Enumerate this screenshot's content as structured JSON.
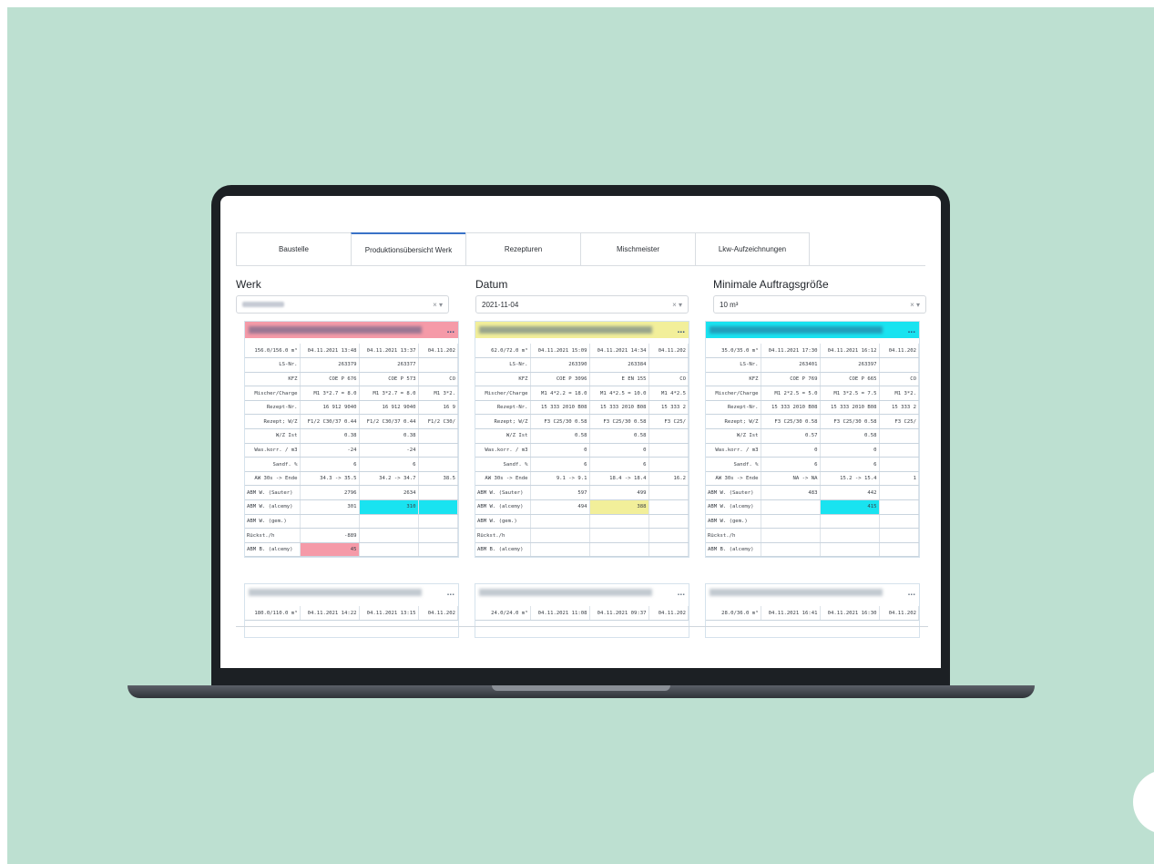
{
  "colors": {
    "background": "#bde0d1",
    "accent": "#3a72c7",
    "cyan": "#19e3f0",
    "yellow": "#f2ef9a",
    "pink": "#f59aa8"
  },
  "tabs": [
    {
      "label": "Baustelle"
    },
    {
      "label": "Produktionsübersicht Werk"
    },
    {
      "label": "Rezepturen"
    },
    {
      "label": "Mischmeister"
    },
    {
      "label": "Lkw-Aufzeichnungen"
    }
  ],
  "filters": {
    "werk": {
      "label": "Werk",
      "value": ""
    },
    "datum": {
      "label": "Datum",
      "value": "2021-11-04"
    },
    "min_size": {
      "label": "Minimale Auftragsgröße",
      "value": "10 m³"
    },
    "clear": "×",
    "caret": "▾"
  },
  "cards": [
    {
      "header_color": "#f59aa8",
      "title_suffix": "...",
      "rows": [
        [
          "156.0/156.0 m³",
          "04.11.2021 13:48",
          "04.11.2021 13:37",
          "04.11.202"
        ],
        [
          "LS-Nr.",
          "263379",
          "263377",
          ""
        ],
        [
          "KFZ",
          "COE P 676",
          "COE P 573",
          "CO"
        ],
        [
          "Mischer/Charge",
          "M1 3*2.7 = 8.0",
          "M1 3*2.7 = 8.0",
          "M1 3*2."
        ],
        [
          "Rezept-Nr.",
          "16 912 9040",
          "16 912 9040",
          "16 9"
        ],
        [
          "Rezept; W/Z",
          "F1/2 C30/37 0.44",
          "F1/2 C30/37 0.44",
          "F1/2 C30/"
        ],
        [
          "W/Z Ist",
          "0.38",
          "0.38",
          ""
        ],
        [
          "Was.korr. / m3",
          "-24",
          "-24",
          ""
        ],
        [
          "Sandf. %",
          "6",
          "6",
          ""
        ],
        [
          "AW 30s -> Ende",
          "34.3 -> 35.5",
          "34.2 -> 34.7",
          "38.5"
        ],
        [
          "ABM W. (Sauter)",
          "2796",
          "2634",
          ""
        ],
        [
          "ABM W. (alcemy)",
          "301",
          "310",
          ""
        ],
        [
          "ABM W. (gem.)",
          "",
          "",
          ""
        ],
        [
          "Rückst./h",
          "-889",
          "",
          ""
        ],
        [
          "ABM B. (alcemy)",
          "45",
          "",
          ""
        ]
      ]
    },
    {
      "header_color": "#f2ef9a",
      "title_suffix": "...",
      "rows": [
        [
          "62.0/72.0 m³",
          "04.11.2021 15:09",
          "04.11.2021 14:34",
          "04.11.202"
        ],
        [
          "LS-Nr.",
          "263390",
          "263384",
          ""
        ],
        [
          "KFZ",
          "COE P 3096",
          "E EN 155",
          "CO"
        ],
        [
          "Mischer/Charge",
          "M1 4*2.2 = 18.0",
          "M1 4*2.5 = 10.0",
          "M1 4*2.5"
        ],
        [
          "Rezept-Nr.",
          "15 333 2010 B08",
          "15 333 2010 B08",
          "15 333 2"
        ],
        [
          "Rezept; W/Z",
          "F3 C25/30 0.58",
          "F3 C25/30 0.58",
          "F3 C25/"
        ],
        [
          "W/Z Ist",
          "0.58",
          "0.58",
          ""
        ],
        [
          "Was.korr. / m3",
          "0",
          "0",
          ""
        ],
        [
          "Sandf. %",
          "6",
          "6",
          ""
        ],
        [
          "AW 30s -> Ende",
          "9.1 -> 9.1",
          "18.4 -> 18.4",
          "16.2"
        ],
        [
          "ABM W. (Sauter)",
          "597",
          "499",
          ""
        ],
        [
          "ABM W. (alcemy)",
          "494",
          "388",
          ""
        ],
        [
          "ABM W. (gem.)",
          "",
          "",
          ""
        ],
        [
          "Rückst./h",
          "",
          "",
          ""
        ],
        [
          "ABM B. (alcemy)",
          "",
          "",
          ""
        ]
      ]
    },
    {
      "header_color": "#19e3f0",
      "title_suffix": "...",
      "rows": [
        [
          "35.0/35.0 m³",
          "04.11.2021 17:30",
          "04.11.2021 16:12",
          "04.11.202"
        ],
        [
          "LS-Nr.",
          "263401",
          "263397",
          ""
        ],
        [
          "KFZ",
          "COE P 769",
          "COE P 665",
          "CO"
        ],
        [
          "Mischer/Charge",
          "M1 2*2.5 = 5.0",
          "M1 3*2.5 = 7.5",
          "M1 3*2."
        ],
        [
          "Rezept-Nr.",
          "15 333 2010 B08",
          "15 333 2010 B08",
          "15 333 2"
        ],
        [
          "Rezept; W/Z",
          "F3 C25/30 0.58",
          "F3 C25/30 0.58",
          "F3 C25/"
        ],
        [
          "W/Z Ist",
          "0.57",
          "0.58",
          ""
        ],
        [
          "Was.korr. / m3",
          "0",
          "0",
          ""
        ],
        [
          "Sandf. %",
          "6",
          "6",
          ""
        ],
        [
          "AW 30s -> Ende",
          "NA -> NA",
          "15.2 -> 15.4",
          "1"
        ],
        [
          "ABM W. (Sauter)",
          "483",
          "442",
          ""
        ],
        [
          "ABM W. (alcemy)",
          "",
          "415",
          ""
        ],
        [
          "ABM W. (gem.)",
          "",
          "",
          ""
        ],
        [
          "Rückst./h",
          "",
          "",
          ""
        ],
        [
          "ABM B. (alcemy)",
          "",
          "",
          ""
        ]
      ]
    }
  ],
  "cards_second_row": [
    {
      "title_suffix": "...",
      "row": [
        "180.0/110.0 m³",
        "04.11.2021 14:22",
        "04.11.2021 13:15",
        "04.11.202"
      ]
    },
    {
      "title_suffix": "...",
      "row": [
        "24.0/24.0 m³",
        "04.11.2021 11:08",
        "04.11.2021 09:37",
        "04.11.202"
      ]
    },
    {
      "title_suffix": "...",
      "row": [
        "28.0/36.0 m³",
        "04.11.2021 16:41",
        "04.11.2021 16:30",
        "04.11.202"
      ]
    }
  ]
}
